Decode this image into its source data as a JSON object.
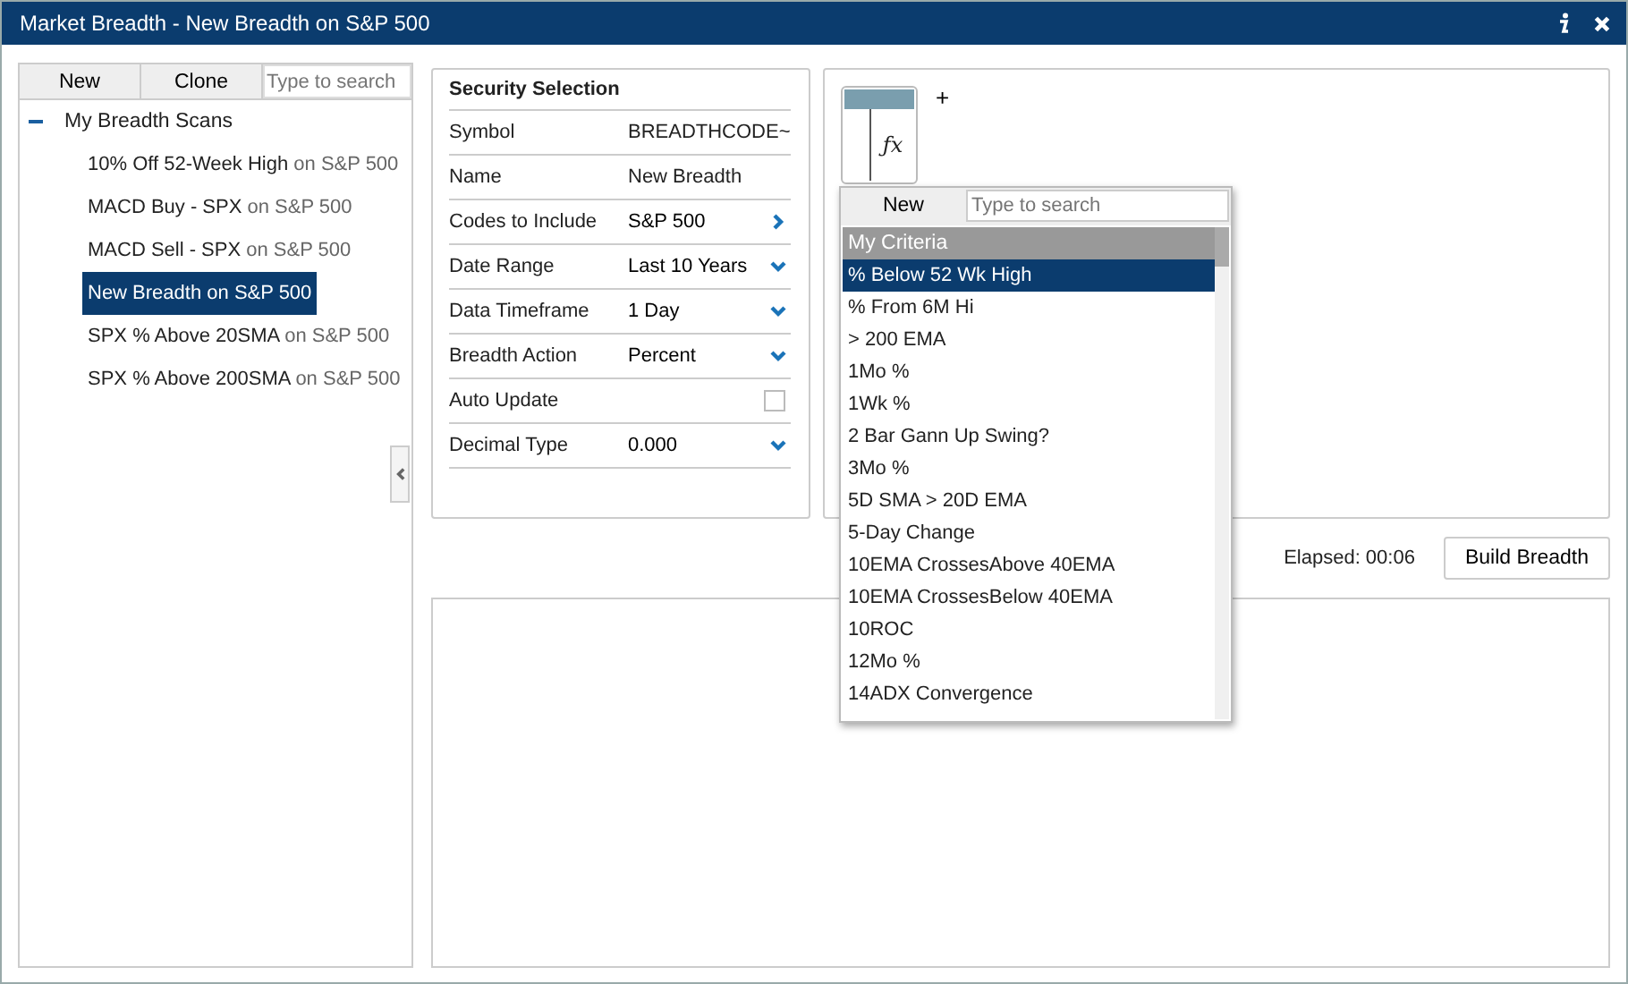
{
  "window": {
    "title": "Market Breadth - New Breadth on S&P 500"
  },
  "scans": {
    "buttons": [
      "New",
      "Clone"
    ],
    "search": {
      "placeholder": "Type to search"
    },
    "tree": {
      "label": "My Breadth Scans",
      "expanded": true,
      "children": [
        {
          "name": "10% Off 52-Week High",
          "suffix": "on S&P 500",
          "selected": false
        },
        {
          "name": "MACD Buy - SPX",
          "suffix": "on S&P 500",
          "selected": false
        },
        {
          "name": "MACD Sell - SPX",
          "suffix": "on S&P 500",
          "selected": false
        },
        {
          "name": "New Breadth",
          "suffix": "on S&P 500",
          "selected": true
        },
        {
          "name": "SPX % Above 20SMA",
          "suffix": "on S&P 500",
          "selected": false
        },
        {
          "name": "SPX % Above 200SMA",
          "suffix": "on S&P 500",
          "selected": false
        }
      ]
    }
  },
  "security_selection": {
    "title": "Security Selection",
    "rows": [
      {
        "kind": "text",
        "label": "Symbol",
        "value": "BREADTHCODE~"
      },
      {
        "kind": "text",
        "label": "Name",
        "value": "New Breadth"
      },
      {
        "kind": "link",
        "label": "Codes to Include",
        "value": "S&P 500"
      },
      {
        "kind": "dropdown",
        "label": "Date Range",
        "value": "Last 10 Years"
      },
      {
        "kind": "dropdown",
        "label": "Data Timeframe",
        "value": "1 Day"
      },
      {
        "kind": "dropdown",
        "label": "Breadth Action",
        "value": "Percent"
      },
      {
        "kind": "checkbox",
        "label": "Auto Update",
        "checked": false
      },
      {
        "kind": "dropdown",
        "label": "Decimal Type",
        "value": "0.000"
      }
    ]
  },
  "formula": {
    "add_label": "+",
    "fx_label": "ƒx"
  },
  "criteria_menu": {
    "button": "New",
    "search": {
      "placeholder": "Type to search"
    },
    "header": "My Criteria",
    "items": [
      {
        "label": "% Below 52 Wk High",
        "selected": true
      },
      {
        "label": "% From 6M Hi",
        "selected": false
      },
      {
        "label": "> 200 EMA",
        "selected": false
      },
      {
        "label": "1Mo %",
        "selected": false
      },
      {
        "label": "1Wk %",
        "selected": false
      },
      {
        "label": "2 Bar Gann Up Swing?",
        "selected": false
      },
      {
        "label": "3Mo %",
        "selected": false
      },
      {
        "label": "5D SMA > 20D EMA",
        "selected": false
      },
      {
        "label": "5-Day Change",
        "selected": false
      },
      {
        "label": "10EMA CrossesAbove 40EMA",
        "selected": false
      },
      {
        "label": "10EMA CrossesBelow 40EMA",
        "selected": false
      },
      {
        "label": "10ROC",
        "selected": false
      },
      {
        "label": "12Mo %",
        "selected": false
      },
      {
        "label": "14ADX Convergence",
        "selected": false
      }
    ]
  },
  "status": {
    "elapsed": "Elapsed: 00:06",
    "button": "Build Breadth"
  }
}
